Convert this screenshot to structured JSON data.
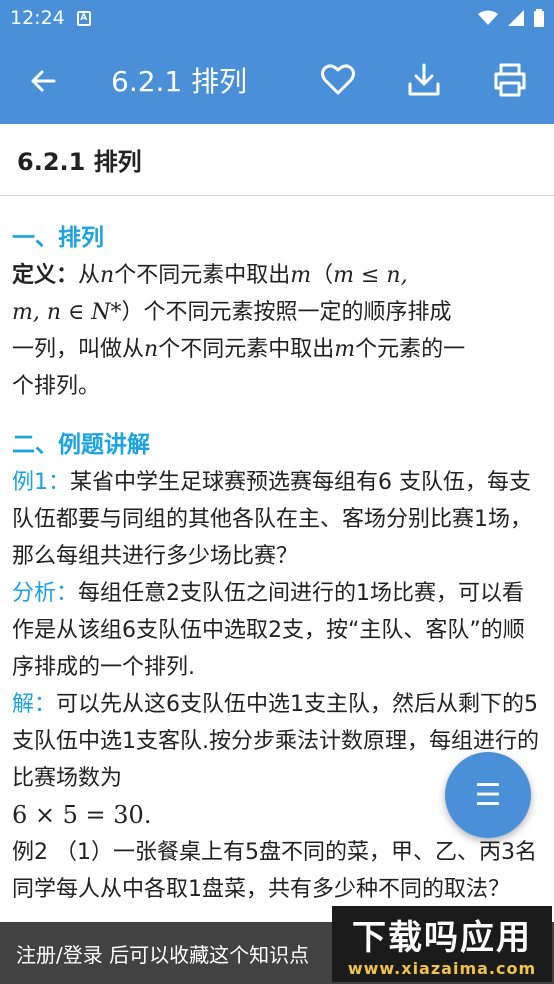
{
  "status_bar": {
    "time": "12:24",
    "notification_icon": "a-letter-icon"
  },
  "app_bar": {
    "title": "6.2.1 排列",
    "icons": [
      "back-arrow-icon",
      "heart-icon",
      "download-icon",
      "print-icon"
    ]
  },
  "page": {
    "header": "6.2.1 排列"
  },
  "content": {
    "section1_title": "一、排列",
    "def_label": "定义",
    "def_colon": "：",
    "def_a": "从",
    "def_n1": "n",
    "def_b": "个不同元素中取出",
    "def_m1": "m",
    "def_c": "（",
    "def_cond1": "m ≤ n,",
    "def_cond2": "m, n ∈ N*",
    "def_d": "）个不同元素按照一定的顺序排成",
    "def_e": "一列，叫做从",
    "def_n2": "n",
    "def_f": "个不同元素中取出",
    "def_m2": "m",
    "def_g": "个元素的一",
    "def_h": "个排列。",
    "section2_title": "二、例题讲解",
    "ex1_label": "例1：",
    "ex1_text": "某省中学生足球赛预选赛每组有6 支队伍，每支队伍都要与同组的其他各队在主、客场分别比赛1场，那么每组共进行多少场比赛？",
    "analysis_label": "分析：",
    "analysis_text": "每组任意2支队伍之间进行的1场比赛，可以看作是从该组6支队伍中选取2支，按“主队、客队”的顺序排成的一个排列.",
    "solution_label": "解：",
    "solution_text": "可以先从这6支队伍中选1支主队，然后从剩下的5支队伍中选1支客队.按分步乘法计数原理，每组进行的比赛场数为",
    "formula": "6 × 5 = 30.",
    "ex2_text": "例2 （1）一张餐桌上有5盘不同的菜，甲、乙、丙3名同学每人从中各取1盘菜，共有多少种不同的取法？"
  },
  "fab": {
    "icon": "menu-icon",
    "label": "☰"
  },
  "toast": {
    "text": "注册/登录 后可以收藏这个知识点"
  },
  "watermark": {
    "cn": "下载吗应用",
    "en": "www.xiazaima.com"
  },
  "colors": {
    "primary": "#4a90d9",
    "accent": "#1aa3e0"
  }
}
